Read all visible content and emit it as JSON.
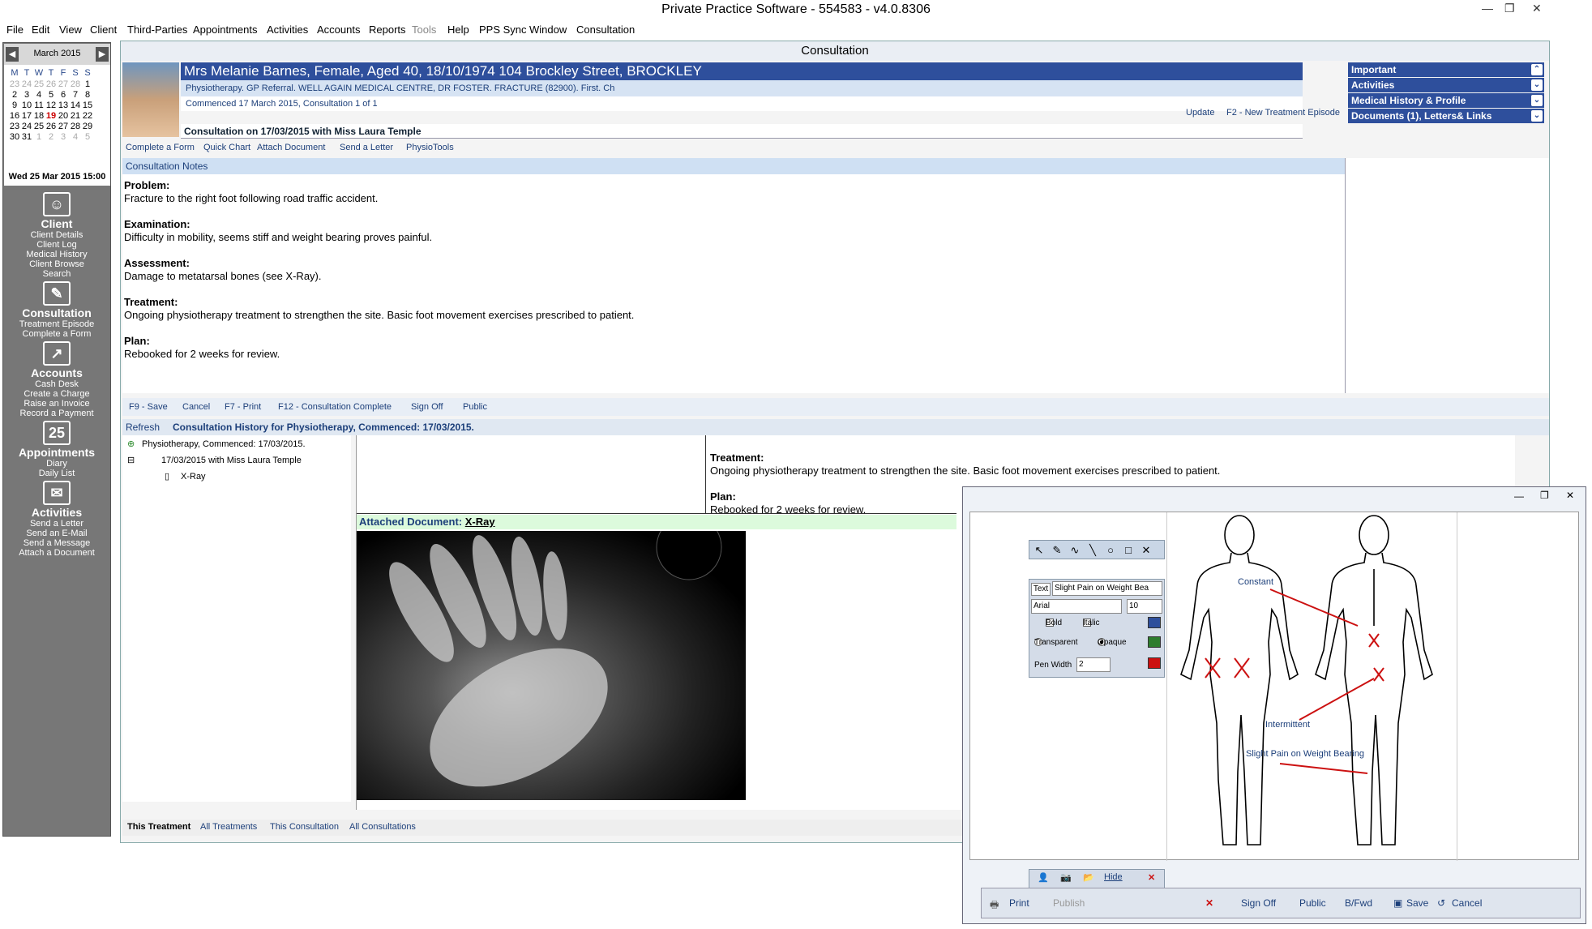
{
  "window": {
    "title": "Private Practice Software - 554583 - v4.0.8306"
  },
  "menu": [
    "File",
    "Edit",
    "View",
    "Client",
    "Third-Parties",
    "Appointments",
    "Activities",
    "Accounts",
    "Reports",
    "Tools",
    "Help",
    "PPS Sync",
    "Window",
    "Consultation"
  ],
  "calendar": {
    "month": "March 2015",
    "dow": [
      "M",
      "T",
      "W",
      "T",
      "F",
      "S",
      "S"
    ],
    "weeks": [
      [
        "23",
        "24",
        "25",
        "26",
        "27",
        "28",
        "1"
      ],
      [
        "2",
        "3",
        "4",
        "5",
        "6",
        "7",
        "8"
      ],
      [
        "9",
        "10",
        "11",
        "12",
        "13",
        "14",
        "15"
      ],
      [
        "16",
        "17",
        "18",
        "19",
        "20",
        "21",
        "22"
      ],
      [
        "23",
        "24",
        "25",
        "26",
        "27",
        "28",
        "29"
      ],
      [
        "30",
        "31",
        "1",
        "2",
        "3",
        "4",
        "5"
      ]
    ],
    "now": "Wed 25 Mar 2015 15:00"
  },
  "nav": {
    "client": {
      "title": "Client",
      "items": [
        "Client Details",
        "Client Log",
        "Medical History",
        "Client Browse",
        "Search"
      ]
    },
    "consultation": {
      "title": "Consultation",
      "items": [
        "Treatment Episode",
        "Complete a Form"
      ]
    },
    "accounts": {
      "title": "Accounts",
      "items": [
        "Cash Desk",
        "Create a Charge",
        "Raise an Invoice",
        "Record a Payment"
      ]
    },
    "appointments": {
      "title": "Appointments",
      "icon_text": "25",
      "items": [
        "Diary",
        "Daily List"
      ]
    },
    "activities": {
      "title": "Activities",
      "items": [
        "Send a Letter",
        "Send an E-Mail",
        "Send a Message",
        "Attach a Document"
      ]
    }
  },
  "consult": {
    "title": "Consultation",
    "patient": "Mrs Melanie Barnes, Female, Aged 40, 18/10/1974 104 Brockley Street, BROCKLEY",
    "referral": "Physiotherapy. GP Referral. WELL AGAIN MEDICAL CENTRE, DR FOSTER. FRACTURE (82900). First. Ch",
    "commenced": "Commenced 17 March 2015, Consultation 1 of 1",
    "update": "Update",
    "new_episode": "F2 - New Treatment Episode",
    "consult_on": "Consultation on 17/03/2015 with Miss Laura Temple",
    "toolbar": [
      "Complete a Form",
      "Quick Chart",
      "Attach Document",
      "Send a Letter",
      "PhysioTools"
    ],
    "notes_header": "Consultation Notes",
    "notes": [
      {
        "label": "Problem:",
        "text": "Fracture to the right foot following road traffic accident."
      },
      {
        "label": "Examination:",
        "text": "Difficulty in mobility, seems stiff and weight bearing proves painful."
      },
      {
        "label": "Assessment:",
        "text": "Damage to metatarsal bones (see X-Ray)."
      },
      {
        "label": "Treatment:",
        "text": "Ongoing physiotherapy treatment to strengthen the site. Basic foot movement exercises prescribed to patient."
      },
      {
        "label": "Plan:",
        "text": "Rebooked for 2 weeks for review."
      }
    ],
    "right_panels": [
      "Important",
      "Activities",
      "Medical History & Profile",
      "Documents (1), Letters& Links"
    ],
    "actions": [
      "F9 - Save",
      "Cancel",
      "F7 - Print",
      "F12 - Consultation Complete",
      "Sign Off",
      "Public"
    ],
    "history": {
      "refresh": "Refresh",
      "title": "Consultation History for Physiotherapy, Commenced: 17/03/2015.",
      "tree": [
        "Physiotherapy, Commenced: 17/03/2015.",
        "17/03/2015 with Miss Laura Temple",
        "X-Ray"
      ],
      "treatment_label": "Treatment:",
      "treatment_text": "Ongoing physiotherapy treatment to strengthen the site. Basic foot movement exercises prescribed to patient.",
      "plan_label": "Plan:",
      "plan_text": "Rebooked for 2 weeks for review.",
      "attached_label": "Attached Document:",
      "attached_name": "X-Ray"
    },
    "tabs": [
      "This Treatment",
      "All Treatments",
      "This Consultation",
      "All Consultations"
    ]
  },
  "chart_dialog": {
    "text_label": "Text",
    "text_value": "Slight Pain on Weight Bea",
    "font": "Arial",
    "size": "10",
    "bold": "Bold",
    "italic": "Italic",
    "transparent": "Transparent",
    "opaque": "Opaque",
    "pen_width_label": "Pen Width",
    "pen_width": "2",
    "hide": "Hide",
    "annotations": [
      "Constant",
      "Intermittent",
      "Slight Pain on Weight Bearing"
    ],
    "buttons": [
      "Print",
      "Publish",
      "Sign Off",
      "Public",
      "B/Fwd",
      "Save",
      "Cancel"
    ]
  },
  "colors": {
    "accent": "#2e4f9c",
    "annotation": "#cc1111",
    "panel": "#777777"
  }
}
